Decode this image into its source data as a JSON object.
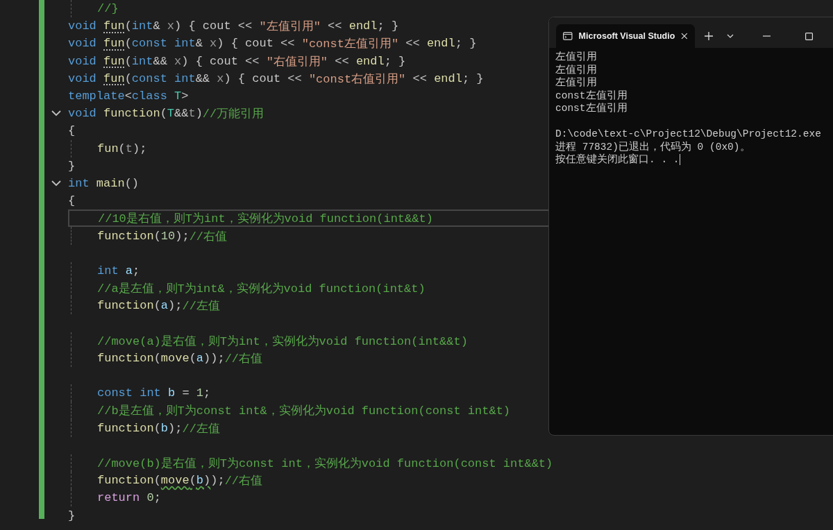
{
  "editor": {
    "lines": [
      {
        "foldable": false,
        "indented": true,
        "current": false,
        "space_before": false,
        "tokens": [
          {
            "kind": "cm",
            "text": "//}"
          }
        ]
      },
      {
        "foldable": false,
        "indented": false,
        "current": false,
        "space_before": false,
        "tokens": [
          {
            "kind": "kw",
            "text": "void "
          },
          {
            "kind": "fn",
            "text": "fun",
            "dotted": true
          },
          {
            "kind": "pl",
            "text": "("
          },
          {
            "kind": "kw",
            "text": "int"
          },
          {
            "kind": "pl",
            "text": "& "
          },
          {
            "kind": "prm",
            "text": "x"
          },
          {
            "kind": "pl",
            "text": ") { cout << "
          },
          {
            "kind": "str",
            "text": "\"左值引用\""
          },
          {
            "kind": "pl",
            "text": " << "
          },
          {
            "kind": "fn",
            "text": "endl"
          },
          {
            "kind": "pl",
            "text": "; }"
          }
        ]
      },
      {
        "foldable": false,
        "indented": false,
        "current": false,
        "space_before": false,
        "tokens": [
          {
            "kind": "kw",
            "text": "void "
          },
          {
            "kind": "fn",
            "text": "fun",
            "dotted": true
          },
          {
            "kind": "pl",
            "text": "("
          },
          {
            "kind": "kw",
            "text": "const int"
          },
          {
            "kind": "pl",
            "text": "& "
          },
          {
            "kind": "prm",
            "text": "x"
          },
          {
            "kind": "pl",
            "text": ") { cout << "
          },
          {
            "kind": "str",
            "text": "\"const左值引用\""
          },
          {
            "kind": "pl",
            "text": " << "
          },
          {
            "kind": "fn",
            "text": "endl"
          },
          {
            "kind": "pl",
            "text": "; }"
          }
        ]
      },
      {
        "foldable": false,
        "indented": false,
        "current": false,
        "space_before": false,
        "tokens": [
          {
            "kind": "kw",
            "text": "void "
          },
          {
            "kind": "fn",
            "text": "fun",
            "dotted": true
          },
          {
            "kind": "pl",
            "text": "("
          },
          {
            "kind": "kw",
            "text": "int"
          },
          {
            "kind": "pl",
            "text": "&& "
          },
          {
            "kind": "prm",
            "text": "x"
          },
          {
            "kind": "pl",
            "text": ") { cout << "
          },
          {
            "kind": "str",
            "text": "\"右值引用\""
          },
          {
            "kind": "pl",
            "text": " << "
          },
          {
            "kind": "fn",
            "text": "endl"
          },
          {
            "kind": "pl",
            "text": "; }"
          }
        ]
      },
      {
        "foldable": false,
        "indented": false,
        "current": false,
        "space_before": false,
        "tokens": [
          {
            "kind": "kw",
            "text": "void "
          },
          {
            "kind": "fn",
            "text": "fun",
            "dotted": true
          },
          {
            "kind": "pl",
            "text": "("
          },
          {
            "kind": "kw",
            "text": "const int"
          },
          {
            "kind": "pl",
            "text": "&& "
          },
          {
            "kind": "prm",
            "text": "x"
          },
          {
            "kind": "pl",
            "text": ") { cout << "
          },
          {
            "kind": "str",
            "text": "\"const右值引用\""
          },
          {
            "kind": "pl",
            "text": " << "
          },
          {
            "kind": "fn",
            "text": "endl"
          },
          {
            "kind": "pl",
            "text": "; }"
          }
        ]
      },
      {
        "foldable": false,
        "indented": false,
        "current": false,
        "space_before": false,
        "tokens": [
          {
            "kind": "kw",
            "text": "template"
          },
          {
            "kind": "pl",
            "text": "<"
          },
          {
            "kind": "kw",
            "text": "class "
          },
          {
            "kind": "type",
            "text": "T"
          },
          {
            "kind": "pl",
            "text": ">"
          }
        ]
      },
      {
        "foldable": true,
        "indented": false,
        "current": false,
        "space_before": false,
        "tokens": [
          {
            "kind": "kw",
            "text": "void "
          },
          {
            "kind": "fn",
            "text": "function"
          },
          {
            "kind": "pl",
            "text": "("
          },
          {
            "kind": "type",
            "text": "T"
          },
          {
            "kind": "pl",
            "text": "&&"
          },
          {
            "kind": "prm",
            "text": "t"
          },
          {
            "kind": "pl",
            "text": ")"
          },
          {
            "kind": "cm",
            "text": "//万能引用"
          }
        ]
      },
      {
        "foldable": false,
        "indented": false,
        "current": false,
        "space_before": false,
        "tokens": [
          {
            "kind": "pl",
            "text": "{"
          }
        ]
      },
      {
        "foldable": false,
        "indented": true,
        "current": false,
        "space_before": false,
        "tokens": [
          {
            "kind": "fn",
            "text": "fun"
          },
          {
            "kind": "pl",
            "text": "("
          },
          {
            "kind": "prm",
            "text": "t"
          },
          {
            "kind": "pl",
            "text": ");"
          }
        ]
      },
      {
        "foldable": false,
        "indented": false,
        "current": false,
        "space_before": false,
        "tokens": [
          {
            "kind": "pl",
            "text": "}"
          }
        ]
      },
      {
        "foldable": true,
        "indented": false,
        "current": false,
        "space_before": false,
        "tokens": [
          {
            "kind": "kw",
            "text": "int "
          },
          {
            "kind": "fn",
            "text": "main"
          },
          {
            "kind": "pl",
            "text": "()"
          }
        ]
      },
      {
        "foldable": false,
        "indented": false,
        "current": false,
        "space_before": false,
        "tokens": [
          {
            "kind": "pl",
            "text": "{"
          }
        ]
      },
      {
        "foldable": false,
        "indented": true,
        "current": true,
        "space_before": false,
        "tokens": [
          {
            "kind": "cm",
            "text": "//10是右值，则T为int，实例化为void function(int&&t)"
          }
        ]
      },
      {
        "foldable": false,
        "indented": true,
        "current": false,
        "space_before": false,
        "tokens": [
          {
            "kind": "fn",
            "text": "function"
          },
          {
            "kind": "pl",
            "text": "("
          },
          {
            "kind": "num",
            "text": "10"
          },
          {
            "kind": "pl",
            "text": ");"
          },
          {
            "kind": "cm",
            "text": "//右值"
          }
        ]
      },
      {
        "foldable": false,
        "indented": true,
        "current": false,
        "space_before": true,
        "tokens": [
          {
            "kind": "kw",
            "text": "int "
          },
          {
            "kind": "var",
            "text": "a"
          },
          {
            "kind": "pl",
            "text": ";"
          }
        ]
      },
      {
        "foldable": false,
        "indented": true,
        "current": false,
        "space_before": false,
        "tokens": [
          {
            "kind": "cm",
            "text": "//a是左值，则T为int&，实例化为void function(int&t)"
          }
        ]
      },
      {
        "foldable": false,
        "indented": true,
        "current": false,
        "space_before": false,
        "tokens": [
          {
            "kind": "fn",
            "text": "function"
          },
          {
            "kind": "pl",
            "text": "("
          },
          {
            "kind": "var",
            "text": "a"
          },
          {
            "kind": "pl",
            "text": ");"
          },
          {
            "kind": "cm",
            "text": "//左值"
          }
        ]
      },
      {
        "foldable": false,
        "indented": true,
        "current": false,
        "space_before": true,
        "tokens": [
          {
            "kind": "cm",
            "text": "//move(a)是右值，则T为int，实例化为void function(int&&t)"
          }
        ]
      },
      {
        "foldable": false,
        "indented": true,
        "current": false,
        "space_before": false,
        "tokens": [
          {
            "kind": "fn",
            "text": "function"
          },
          {
            "kind": "pl",
            "text": "("
          },
          {
            "kind": "fn",
            "text": "move"
          },
          {
            "kind": "pl",
            "text": "("
          },
          {
            "kind": "var",
            "text": "a"
          },
          {
            "kind": "pl",
            "text": "));"
          },
          {
            "kind": "cm",
            "text": "//右值"
          }
        ]
      },
      {
        "foldable": false,
        "indented": true,
        "current": false,
        "space_before": true,
        "tokens": [
          {
            "kind": "kw",
            "text": "const int "
          },
          {
            "kind": "var",
            "text": "b"
          },
          {
            "kind": "pl",
            "text": " = "
          },
          {
            "kind": "num",
            "text": "1"
          },
          {
            "kind": "pl",
            "text": ";"
          }
        ]
      },
      {
        "foldable": false,
        "indented": true,
        "current": false,
        "space_before": false,
        "tokens": [
          {
            "kind": "cm",
            "text": "//b是左值，则T为const int&，实例化为void function(const int&t)"
          }
        ]
      },
      {
        "foldable": false,
        "indented": true,
        "current": false,
        "space_before": false,
        "tokens": [
          {
            "kind": "fn",
            "text": "function"
          },
          {
            "kind": "pl",
            "text": "("
          },
          {
            "kind": "var",
            "text": "b"
          },
          {
            "kind": "pl",
            "text": ");"
          },
          {
            "kind": "cm",
            "text": "//左值"
          }
        ]
      },
      {
        "foldable": false,
        "indented": true,
        "current": false,
        "space_before": true,
        "tokens": [
          {
            "kind": "cm",
            "text": "//move(b)是右值，则T为const int，实例化为void function(const int&&t)"
          }
        ]
      },
      {
        "foldable": false,
        "indented": true,
        "current": false,
        "space_before": false,
        "tokens": [
          {
            "kind": "fn",
            "text": "function"
          },
          {
            "kind": "pl",
            "text": "("
          },
          {
            "kind": "fn",
            "text": "move",
            "wavy": true
          },
          {
            "kind": "pl",
            "text": "(",
            "wavy": true
          },
          {
            "kind": "var",
            "text": "b",
            "wavy": true
          },
          {
            "kind": "pl",
            "text": ")",
            "wavy": true
          },
          {
            "kind": "pl",
            "text": ");"
          },
          {
            "kind": "cm",
            "text": "//右值"
          }
        ]
      },
      {
        "foldable": false,
        "indented": true,
        "current": false,
        "space_before": false,
        "tokens": [
          {
            "kind": "ctl",
            "text": "return "
          },
          {
            "kind": "num",
            "text": "0"
          },
          {
            "kind": "pl",
            "text": ";"
          }
        ]
      },
      {
        "foldable": false,
        "indented": false,
        "current": false,
        "space_before": false,
        "tokens": [
          {
            "kind": "pl",
            "text": "}"
          }
        ]
      }
    ]
  },
  "console": {
    "tab_title": "Microsoft Visual Studio",
    "tab_selected": true,
    "output": [
      "左值引用",
      "左值引用",
      "左值引用",
      "const左值引用",
      "const左值引用"
    ],
    "exit_lines": [
      "D:\\code\\text-c\\Project12\\Debug\\Project12.exe",
      "进程 77832)已退出，代码为 0 (0x0)。",
      "按任意键关闭此窗口. . ."
    ],
    "cursor": true
  }
}
